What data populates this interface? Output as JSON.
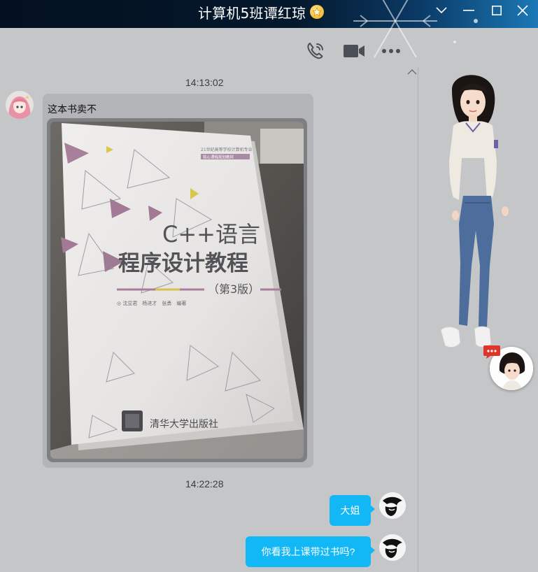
{
  "window": {
    "title": "计算机5班谭红琼",
    "controls": [
      "chevron-down-icon",
      "minimize-icon",
      "maximize-icon",
      "close-icon"
    ]
  },
  "toolbar": {
    "icons": [
      "phone-icon",
      "video-call-icon",
      "more-icon"
    ]
  },
  "messages": [
    {
      "type": "timestamp",
      "text": "14:13:02"
    },
    {
      "type": "received",
      "sender": "contact",
      "text": "这本书卖不",
      "attachment": "photo"
    },
    {
      "type": "timestamp",
      "text": "14:22:28"
    },
    {
      "type": "sent",
      "text": "大姐"
    },
    {
      "type": "sent",
      "text": "你看我上课带过书吗?"
    }
  ],
  "photo": {
    "cover_top_line1": "21世纪高等学校计算机专业",
    "cover_top_line2": "核心课程规划教材",
    "cover_title1": "C++语言",
    "cover_title2": "程序设计教程",
    "cover_edition": "（第3版）",
    "cover_authors": "◎ 沈显君　杨进才　张勇　编著",
    "cover_publisher": "清华大学出版社"
  },
  "colors": {
    "titlebar": "#04182c",
    "chat_bg": "#c5c6c8",
    "sent_bubble": "#12b7f5",
    "recv_bubble": "#b3b4b7"
  }
}
